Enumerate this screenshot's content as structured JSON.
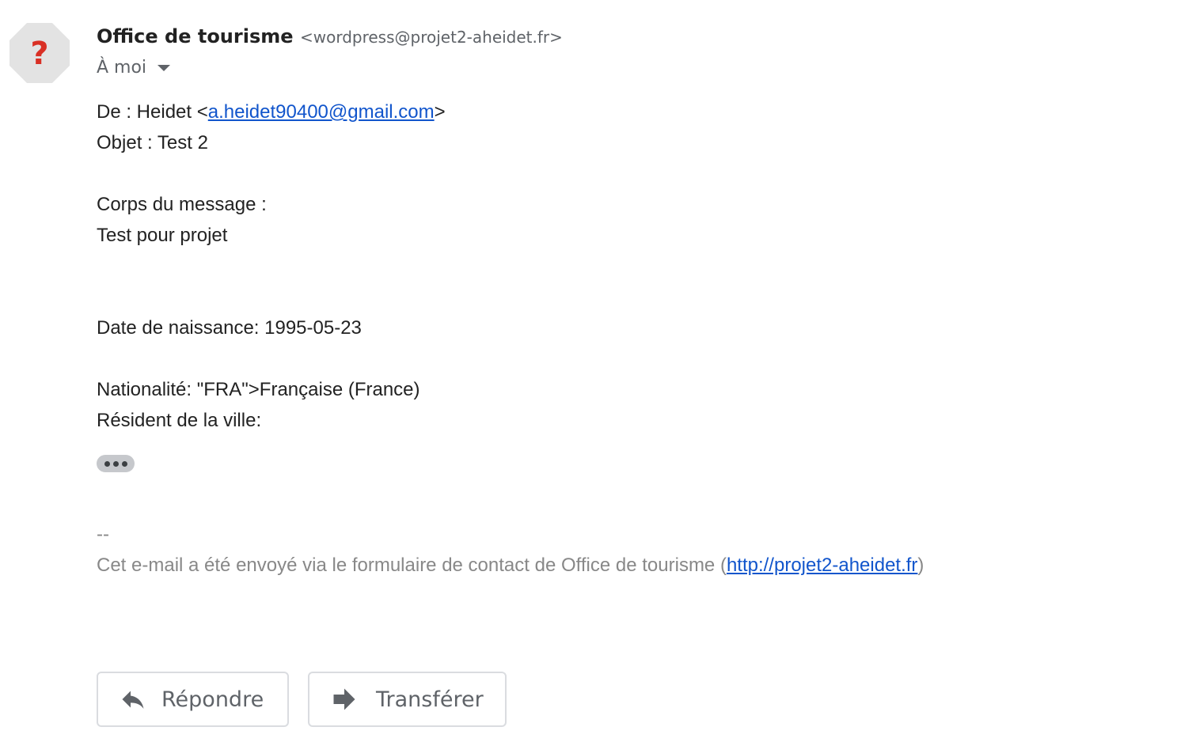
{
  "sender": {
    "name": "Office de tourisme",
    "email": "<wordpress@projet2-aheidet.fr>",
    "avatar_icon": "question-mark-icon",
    "avatar_glyph": "?"
  },
  "recipient": {
    "label": "À moi",
    "dropdown_icon": "chevron-down-icon"
  },
  "message": {
    "from_prefix": "De : Heidet <",
    "from_email": "a.heidet90400@gmail.com",
    "from_suffix": ">",
    "subject": "Objet : Test 2",
    "body_heading": "Corps du message :",
    "body_text": "Test pour projet",
    "birth_date": "Date de naissance: 1995-05-23",
    "nationality": "Nationalité: \"FRA\">Française (France)",
    "resident": "Résident de la ville:",
    "signature_separator": "--",
    "footer_prefix": "Cet e-mail a été envoyé via le formulaire de contact de Office de tourisme (",
    "footer_link": "http://projet2-aheidet.fr",
    "footer_suffix": ")"
  },
  "actions": {
    "reply_label": "Répondre",
    "reply_icon": "reply-arrow-icon",
    "forward_label": "Transférer",
    "forward_icon": "forward-arrow-icon",
    "expand_icon": "ellipsis-icon"
  },
  "colors": {
    "link": "#1155cc",
    "avatar_bg": "#e3e3e3",
    "avatar_glyph": "#d93025",
    "muted_text": "#5f6368",
    "footer_text": "#888888"
  }
}
